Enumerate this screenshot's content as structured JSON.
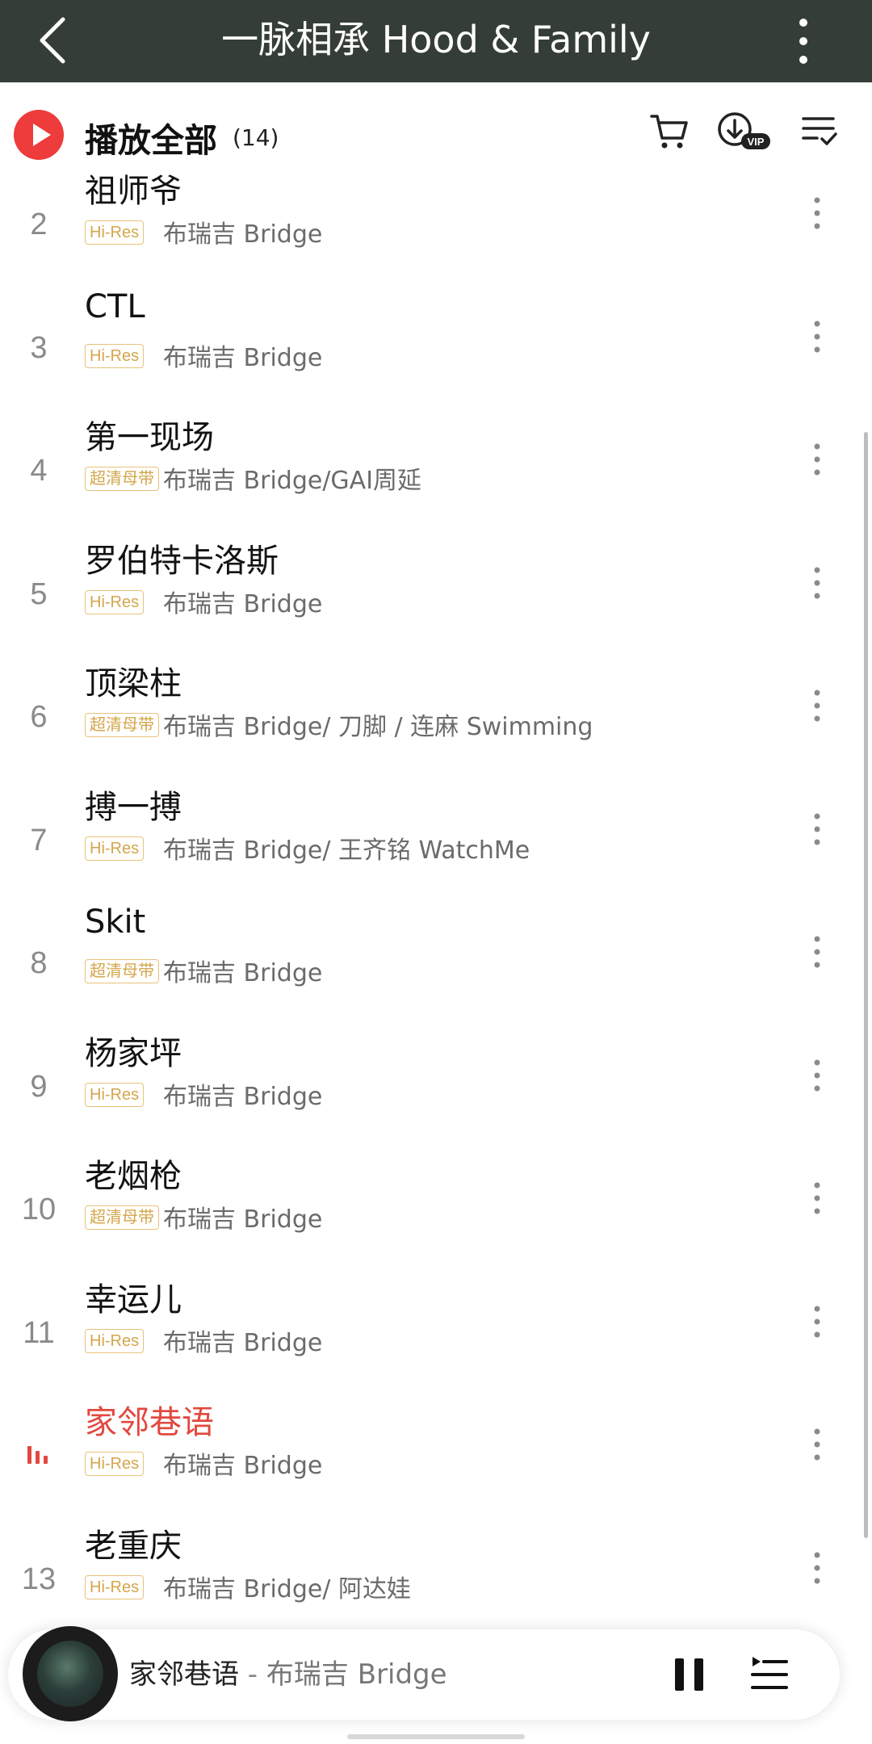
{
  "topbar": {
    "title": "一脉相承 Hood & Family"
  },
  "header": {
    "play_all_label": "播放全部",
    "count": "(14)"
  },
  "tracks": [
    {
      "number": "2",
      "title": "祖师爷",
      "quality": "Hi-Res",
      "artist": "布瑞吉 Bridge"
    },
    {
      "number": "3",
      "title": "CTL",
      "quality": "Hi-Res",
      "artist": "布瑞吉 Bridge"
    },
    {
      "number": "4",
      "title": "第一现场",
      "quality": "超清母带",
      "artist": "布瑞吉 Bridge/GAI周延"
    },
    {
      "number": "5",
      "title": "罗伯特卡洛斯",
      "quality": "Hi-Res",
      "artist": "布瑞吉 Bridge"
    },
    {
      "number": "6",
      "title": "顶梁柱",
      "quality": "超清母带",
      "artist": "布瑞吉 Bridge/ 刀脚 / 连麻 Swimming"
    },
    {
      "number": "7",
      "title": "搏一搏",
      "quality": "Hi-Res",
      "artist": "布瑞吉 Bridge/ 王齐铭 WatchMe"
    },
    {
      "number": "8",
      "title": "Skit",
      "quality": "超清母带",
      "artist": "布瑞吉 Bridge"
    },
    {
      "number": "9",
      "title": "杨家坪",
      "quality": "Hi-Res",
      "artist": "布瑞吉 Bridge"
    },
    {
      "number": "10",
      "title": "老烟枪",
      "quality": "超清母带",
      "artist": "布瑞吉 Bridge"
    },
    {
      "number": "11",
      "title": "幸运儿",
      "quality": "Hi-Res",
      "artist": "布瑞吉 Bridge"
    },
    {
      "number": "",
      "title": "家邻巷语",
      "quality": "Hi-Res",
      "artist": "布瑞吉 Bridge",
      "playing": true
    },
    {
      "number": "13",
      "title": "老重庆",
      "quality": "Hi-Res",
      "artist": "布瑞吉 Bridge/ 阿达娃"
    }
  ],
  "now_playing": {
    "title": "家邻巷语",
    "separator": " - ",
    "artist": "布瑞吉 Bridge"
  },
  "colors": {
    "accent_red": "#ee3b3b",
    "playing_red": "#e2483f",
    "topbar": "#353d37",
    "tag_gold": "#d4a64b"
  }
}
